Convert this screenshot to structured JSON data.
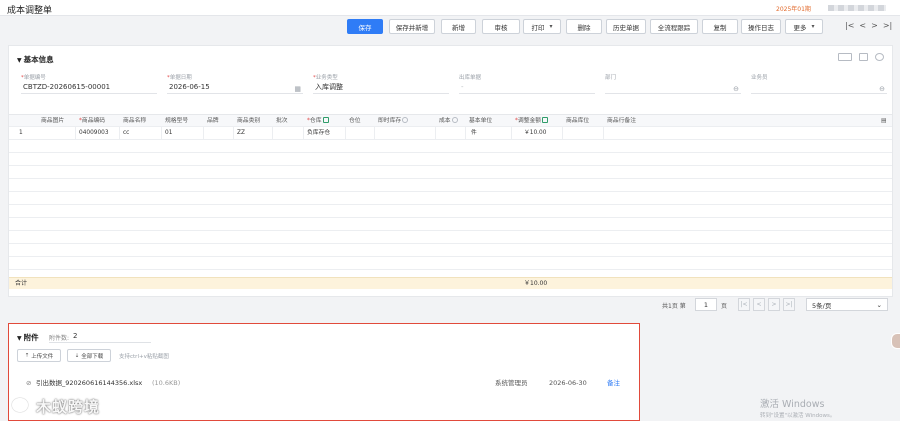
{
  "app": {
    "title": "成本调整单",
    "period": "2025年01期"
  },
  "toolbar": {
    "buttons": [
      "保存",
      "保存并新增",
      "新增",
      "审核",
      "打印",
      "删除",
      "历史单据",
      "全流程跟踪",
      "复制",
      "操作日志",
      "更多"
    ],
    "nav": [
      "|<",
      "<",
      ">",
      ">|"
    ]
  },
  "basic": {
    "title": "基本信息",
    "fields": [
      {
        "label": "单据编号",
        "required": "*",
        "value": "CBTZD-20260615-00001"
      },
      {
        "label": "单据日期",
        "required": "*",
        "value": "2026-06-15"
      },
      {
        "label": "业务类型",
        "required": "*",
        "value": "入库调整"
      },
      {
        "label": "出库单据",
        "required": "",
        "value": "-"
      },
      {
        "label": "部门",
        "required": "",
        "value": ""
      },
      {
        "label": "业务员",
        "required": "",
        "value": ""
      }
    ]
  },
  "grid": {
    "headers": [
      "商品图片",
      "商品编码",
      "商品名称",
      "规格型号",
      "品牌",
      "商品类别",
      "批次",
      "仓库",
      "仓位",
      "即时库存",
      "成本",
      "基本单位",
      "调整金额",
      "商品库位",
      "商品行备注"
    ],
    "required_marks": [
      "",
      "*",
      "",
      "",
      "",
      "",
      "",
      "*",
      "",
      "",
      "",
      "",
      "*",
      "",
      ""
    ],
    "row": {
      "index": "1",
      "code": "04009003",
      "name": "cc",
      "spec": "01",
      "brand": "",
      "category": "ZZ",
      "batch": "",
      "warehouse": "负库存仓",
      "location": "",
      "stock": "",
      "cost": "",
      "unit": "件",
      "amount": "￥10.00"
    },
    "total_label": "合计",
    "total_amount": "￥10.00"
  },
  "pager": {
    "total_text": "共1页 第",
    "page": "1",
    "page_suffix": "页",
    "page_size": "5条/页",
    "buttons": [
      "|<",
      "<",
      ">",
      ">|"
    ]
  },
  "attachments": {
    "title": "附件",
    "count_label": "附件数:",
    "count": "2",
    "upload_label": "上传文件",
    "download_label": "全部下载",
    "hint": "支持ctrl+v粘贴截图",
    "file": {
      "name": "引出数据_920260616144356.xlsx",
      "size": "(10.6KB)",
      "user": "系统管理员",
      "date": "2026-06-30",
      "action": "备注"
    }
  },
  "watermark": "木蚁跨境",
  "activation": {
    "title": "激活 Windows",
    "subtitle": "转到\"设置\"以激活 Windows。"
  }
}
